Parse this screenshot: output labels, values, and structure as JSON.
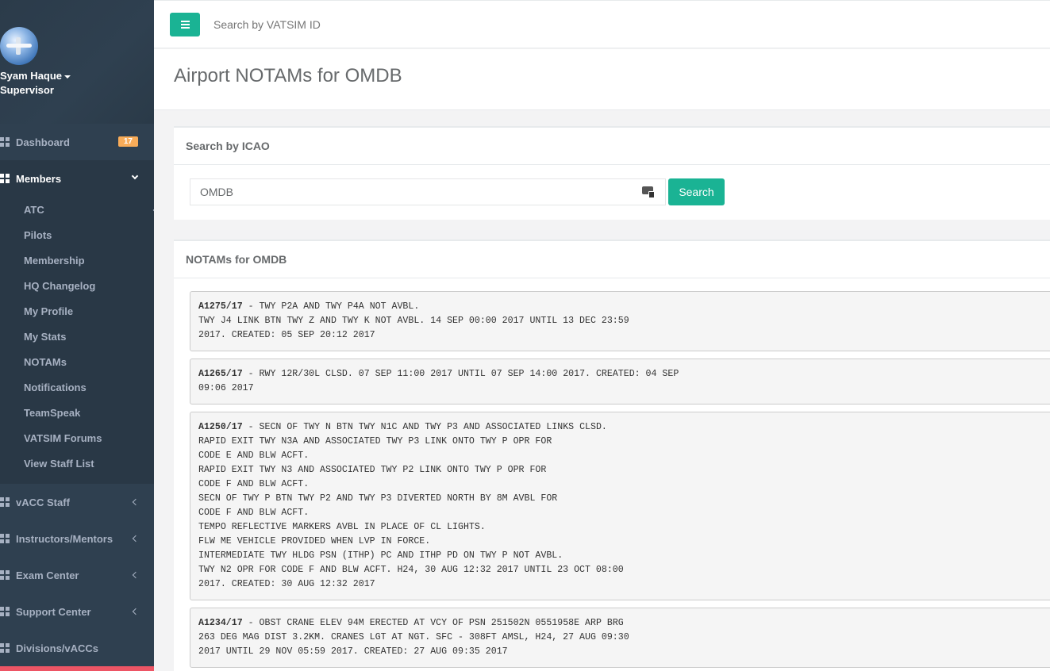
{
  "sidebar": {
    "user_name": "Syam Haque",
    "user_role": "Supervisor",
    "items": [
      {
        "label": "Dashboard",
        "badge": "17"
      },
      {
        "label": "Members"
      },
      {
        "label": "vACC Staff"
      },
      {
        "label": "Instructors/Mentors"
      },
      {
        "label": "Exam Center"
      },
      {
        "label": "Support Center"
      },
      {
        "label": "Divisions/vACCs"
      }
    ],
    "members_submenu": [
      {
        "label": "ATC"
      },
      {
        "label": "Pilots"
      },
      {
        "label": "Membership"
      },
      {
        "label": "HQ Changelog"
      },
      {
        "label": "My Profile"
      },
      {
        "label": "My Stats"
      },
      {
        "label": "NOTAMs"
      },
      {
        "label": "Notifications"
      },
      {
        "label": "TeamSpeak"
      },
      {
        "label": "VATSIM Forums"
      },
      {
        "label": "View Staff List"
      }
    ]
  },
  "topbar": {
    "search_placeholder": "Search by VATSIM ID"
  },
  "page": {
    "title": "Airport NOTAMs for OMDB"
  },
  "search_panel": {
    "title": "Search by ICAO",
    "icao_value": "OMDB",
    "button_label": "Search"
  },
  "notams_panel": {
    "title": "NOTAMs for OMDB",
    "notams": [
      {
        "id": "A1275/17",
        "text": " - TWY P2A AND TWY P4A NOT AVBL.\nTWY J4 LINK BTN TWY Z AND TWY K NOT AVBL. 14 SEP 00:00 2017 UNTIL 13 DEC 23:59\n2017. CREATED: 05 SEP 20:12 2017"
      },
      {
        "id": "A1265/17",
        "text": " - RWY 12R/30L CLSD. 07 SEP 11:00 2017 UNTIL 07 SEP 14:00 2017. CREATED: 04 SEP\n09:06 2017"
      },
      {
        "id": "A1250/17",
        "text": " - SECN OF TWY N BTN TWY N1C AND TWY P3 AND ASSOCIATED LINKS CLSD.\nRAPID EXIT TWY N3A AND ASSOCIATED TWY P3 LINK ONTO TWY P OPR FOR\nCODE E AND BLW ACFT.\nRAPID EXIT TWY N3 AND ASSOCIATED TWY P2 LINK ONTO TWY P OPR FOR\nCODE F AND BLW ACFT.\nSECN OF TWY P BTN TWY P2 AND TWY P3 DIVERTED NORTH BY 8M AVBL FOR\nCODE F AND BLW ACFT.\nTEMPO REFLECTIVE MARKERS AVBL IN PLACE OF CL LIGHTS.\nFLW ME VEHICLE PROVIDED WHEN LVP IN FORCE.\nINTERMEDIATE TWY HLDG PSN (ITHP) PC AND ITHP PD ON TWY P NOT AVBL.\nTWY N2 OPR FOR CODE F AND BLW ACFT. H24, 30 AUG 12:32 2017 UNTIL 23 OCT 08:00\n2017. CREATED: 30 AUG 12:32 2017"
      },
      {
        "id": "A1234/17",
        "text": " - OBST CRANE ELEV 94M ERECTED AT VCY OF PSN 251502N 0551958E ARP BRG\n263 DEG MAG DIST 3.2KM. CRANES LGT AT NGT. SFC - 308FT AMSL, H24, 27 AUG 09:30\n2017 UNTIL 29 NOV 05:59 2017. CREATED: 27 AUG 09:35 2017"
      }
    ]
  }
}
